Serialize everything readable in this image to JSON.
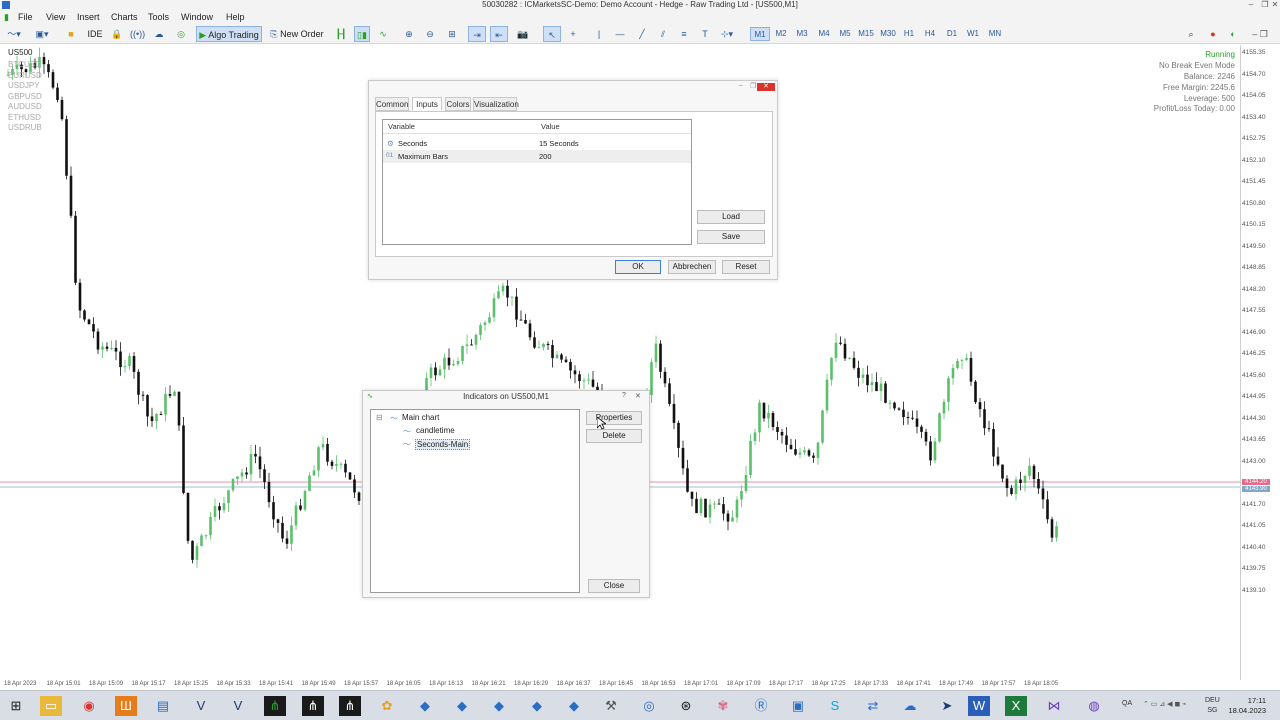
{
  "window": {
    "title": "50030282 : ICMarketsSC-Demo: Demo Account - Hedge - Raw Trading Ltd - [US500,M1]"
  },
  "menu": [
    "File",
    "View",
    "Insert",
    "Charts",
    "Tools",
    "Window",
    "Help"
  ],
  "toolbar": {
    "ide": "IDE",
    "algo_trading": "Algo Trading",
    "new_order": "New Order",
    "timeframes": [
      "M1",
      "M2",
      "M3",
      "M4",
      "M5",
      "M15",
      "M30",
      "H1",
      "H4",
      "D1",
      "W1",
      "MN"
    ],
    "active_timeframe": "M1"
  },
  "chart": {
    "symbol": "US500",
    "symbols": [
      "BTCUSD",
      "EURUSD",
      "USDJPY",
      "GBPUSD",
      "AUDUSD",
      "ETHUSD",
      "USDRUB"
    ],
    "info": [
      "Running",
      "No Break Even Mode",
      "Balance: 2246",
      "Free Margin: 2245.6",
      "Leverage: 500",
      "Profit/Loss Today: 0.00"
    ],
    "price_labels": [
      "4155.35",
      "4154.70",
      "4154.05",
      "4153.40",
      "4152.75",
      "4152.10",
      "4151.45",
      "4150.80",
      "4150.15",
      "4149.50",
      "4148.85",
      "4148.20",
      "4147.55",
      "4146.90",
      "4146.25",
      "4145.60",
      "4144.95",
      "4144.30",
      "4143.65",
      "4143.00",
      "4142.35",
      "4141.70",
      "4141.05",
      "4140.40",
      "4139.75",
      "4139.10"
    ],
    "bid": "4144.20",
    "ask": "4143.90",
    "time_labels": [
      "18 Apr 2023",
      "18 Apr 15:01",
      "18 Apr 15:09",
      "18 Apr 15:17",
      "18 Apr 15:25",
      "18 Apr 15:33",
      "18 Apr 15:41",
      "18 Apr 15:49",
      "18 Apr 15:57",
      "18 Apr 16:05",
      "18 Apr 16:13",
      "18 Apr 16:21",
      "18 Apr 16:29",
      "18 Apr 16:37",
      "18 Apr 16:45",
      "18 Apr 16:53",
      "18 Apr 17:01",
      "18 Apr 17:09",
      "18 Apr 17:17",
      "18 Apr 17:25",
      "18 Apr 17:33",
      "18 Apr 17:41",
      "18 Apr 17:49",
      "18 Apr 17:57",
      "18 Apr 18:05"
    ],
    "colors": {
      "bull": "#5cbf6c",
      "bear": "#111111",
      "bid_line": "#e66a8a",
      "ask_line": "#7fa8c9"
    }
  },
  "props_dialog": {
    "tabs": [
      "Common",
      "Inputs",
      "Colors",
      "Visualization"
    ],
    "active_tab": "Inputs",
    "header": {
      "variable": "Variable",
      "value": "Value"
    },
    "rows": [
      {
        "icon": "⚙",
        "variable": "Seconds",
        "value": "15 Seconds"
      },
      {
        "icon": "01",
        "variable": "Maximum Bars",
        "value": "200"
      }
    ],
    "load": "Load",
    "save": "Save",
    "ok": "OK",
    "cancel": "Abbrechen",
    "reset": "Reset"
  },
  "ind_dialog": {
    "title": "Indicators on US500,M1",
    "help": "?",
    "tree_root": "Main chart",
    "items": [
      "candletime",
      "Seconds-Main"
    ],
    "properties": "Properties",
    "delete": "Delete",
    "close": "Close"
  },
  "taskbar": {
    "lang": "DEU\nSG",
    "lang_top": "DEU",
    "lang_bottom": "SG",
    "time": "17:11",
    "date": "18.04.2023",
    "tray": "QA"
  }
}
